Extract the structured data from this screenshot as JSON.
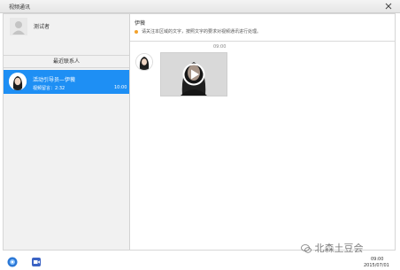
{
  "window": {
    "title": "视频通讯"
  },
  "profile": {
    "name": "测试者"
  },
  "sidebar": {
    "recent_header": "最近联系人",
    "contacts": [
      {
        "name": "活动引导员—伊薇",
        "preview": "视频留言：2:32",
        "time": "10:00"
      }
    ]
  },
  "chat": {
    "peer_name": "伊薇",
    "notice": "请关注本区域的文字，按照文字的要求对视频通讯进行处理。",
    "messages": [
      {
        "time": "09:00",
        "type": "video"
      }
    ]
  },
  "footer": {
    "watermark": "北森土豆会",
    "time": "09:00",
    "date": "2015/07/01"
  },
  "icons": {
    "close": "close-icon",
    "user_placeholder": "user-avatar-placeholder-icon",
    "play": "play-icon",
    "app_left": "app-icon",
    "app_right": "video-app-icon",
    "watermark": "wechat-icon"
  },
  "colors": {
    "accent": "#1e8ff4",
    "notice_dot": "#f2a12b"
  }
}
